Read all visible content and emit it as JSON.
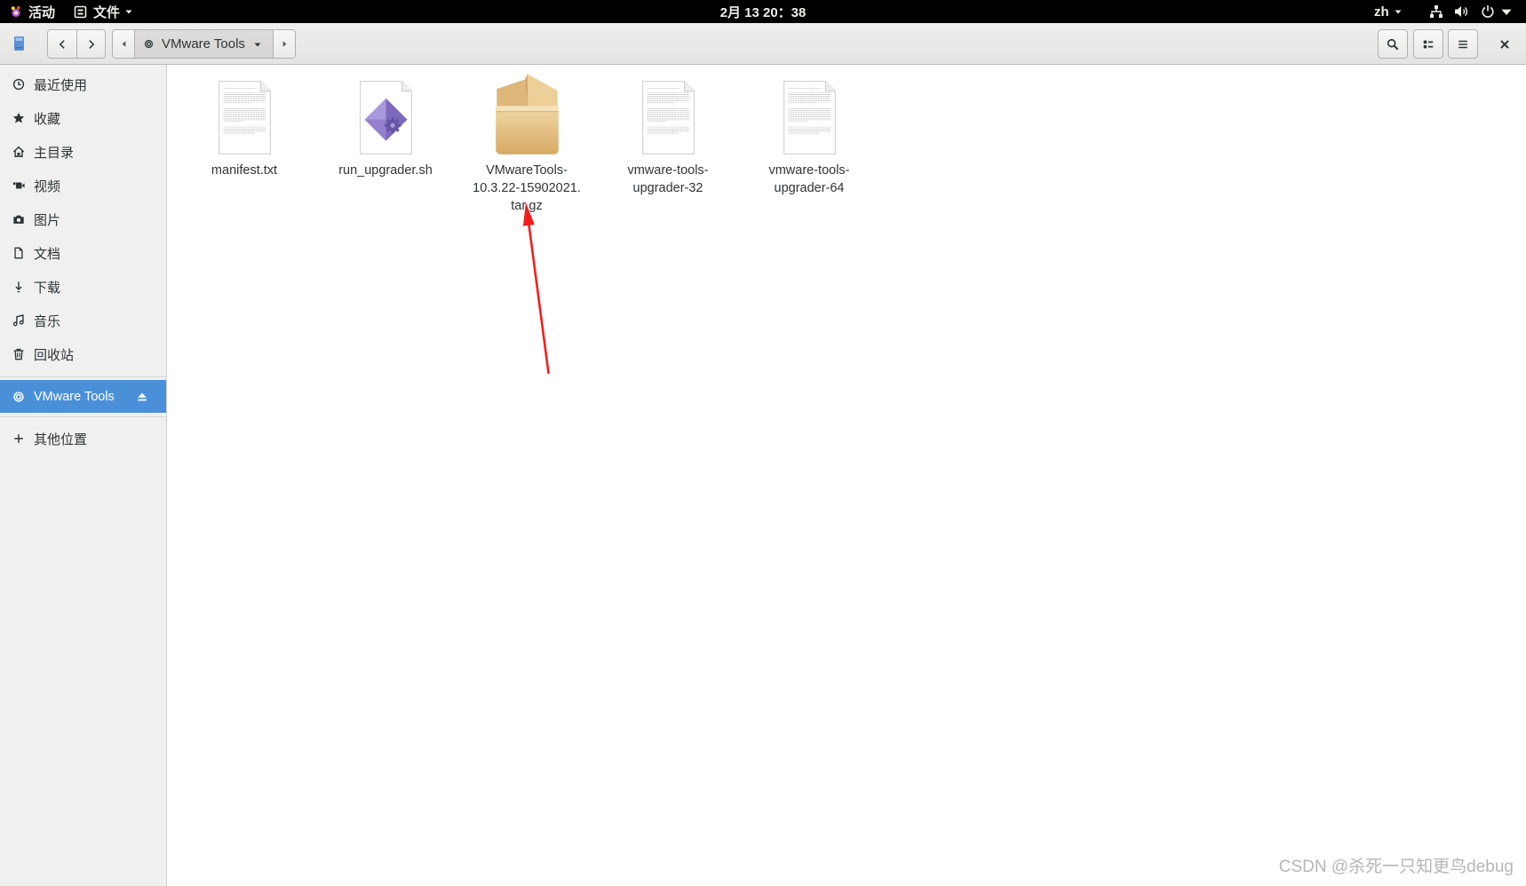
{
  "topbar": {
    "activities": {
      "label": "活动",
      "icon": "activities-logo-icon"
    },
    "app_menu": {
      "label": "文件",
      "icon": "files-app-icon"
    },
    "clock": "2月 13 20：38",
    "language": "zh",
    "status_icons": [
      "network-icon",
      "volume-icon",
      "power-icon"
    ]
  },
  "toolbar": {
    "location": "VMware Tools",
    "icons": [
      "drive-icon",
      "chevron-left-icon",
      "chevron-right-icon",
      "search-icon",
      "view-list-icon",
      "hamburger-menu-icon",
      "close-icon"
    ]
  },
  "sidebar": {
    "places": [
      {
        "label": "最近使用",
        "icon": "clock-icon"
      },
      {
        "label": "收藏",
        "icon": "star-icon"
      },
      {
        "label": "主目录",
        "icon": "home-icon"
      },
      {
        "label": "视频",
        "icon": "video-icon"
      },
      {
        "label": "图片",
        "icon": "camera-icon"
      },
      {
        "label": "文档",
        "icon": "document-icon"
      },
      {
        "label": "下载",
        "icon": "download-icon"
      },
      {
        "label": "音乐",
        "icon": "music-icon"
      },
      {
        "label": "回收站",
        "icon": "trash-icon"
      }
    ],
    "devices": [
      {
        "label": "VMware Tools",
        "icon": "disc-icon",
        "selected": true,
        "action_icon": "eject-icon"
      }
    ],
    "other_locations": {
      "label": "其他位置",
      "icon": "plus-icon"
    }
  },
  "files": [
    {
      "name_lines": [
        "manifest.txt"
      ],
      "icon": "text-file-icon"
    },
    {
      "name_lines": [
        "run_upgrader.sh"
      ],
      "icon": "script-file-icon"
    },
    {
      "name_lines": [
        "VMwareTools-",
        "10.3.22-15902021.",
        "tar.gz"
      ],
      "icon": "archive-icon"
    },
    {
      "name_lines": [
        "vmware-tools-",
        "upgrader-32"
      ],
      "icon": "text-file-icon"
    },
    {
      "name_lines": [
        "vmware-tools-",
        "upgrader-64"
      ],
      "icon": "text-file-icon"
    }
  ],
  "watermark": "CSDN @杀死一只知更鸟debug",
  "colors": {
    "accent": "#4a90d9",
    "topbar": "#000000",
    "sidebar": "#f0f0f0",
    "arrow": "#f21e1e"
  }
}
